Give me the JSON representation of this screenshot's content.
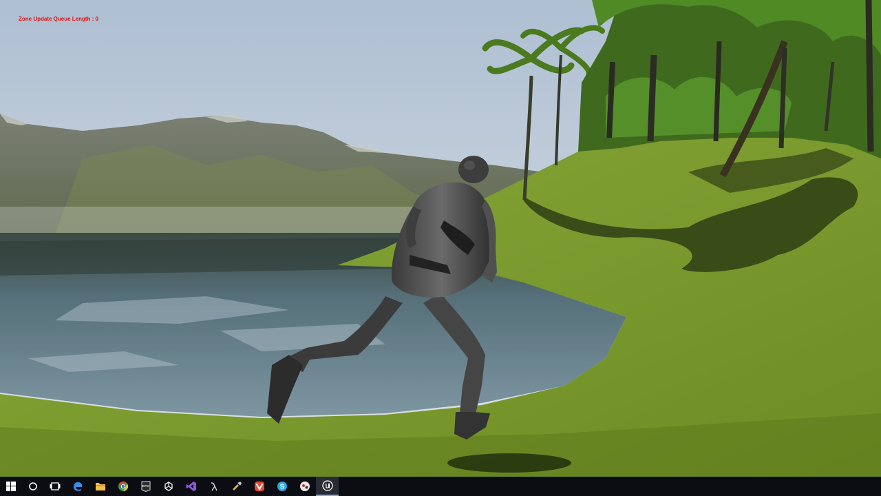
{
  "hud": {
    "zone_update_text": "Zone Update Queue Length : 0",
    "text_color": "#e01010"
  },
  "scene": {
    "sky_top": "#b7c6d6",
    "sky_bottom": "#d8dfe6",
    "mountain_color": "#6f7562",
    "water_color": "#5f7482",
    "grass_color": "#7a9a2c",
    "shadow_color": "#1f2a10",
    "character_color": "#4a4a4a"
  },
  "taskbar": {
    "background": "#0c0d12",
    "items": [
      {
        "name": "windows-start",
        "icon": "windows-logo-icon",
        "color": "#ffffff"
      },
      {
        "name": "search",
        "icon": "cortana-circle-icon",
        "color": "#ffffff"
      },
      {
        "name": "task-view",
        "icon": "task-view-icon",
        "color": "#ffffff"
      },
      {
        "name": "edge",
        "icon": "edge-browser-icon",
        "color": "#3b8ee8"
      },
      {
        "name": "file-explorer",
        "icon": "folder-icon",
        "color": "#f2c04a"
      },
      {
        "name": "chrome",
        "icon": "chrome-icon",
        "color": "#d94a3a"
      },
      {
        "name": "epic-launcher",
        "icon": "epic-games-icon",
        "color": "#dddddd",
        "label": "EPIC"
      },
      {
        "name": "unity",
        "icon": "unity-icon",
        "color": "#eeeeee"
      },
      {
        "name": "visual-studio",
        "icon": "visual-studio-icon",
        "color": "#8a5bd6"
      },
      {
        "name": "app-lambda",
        "icon": "lambda-icon",
        "color": "#dddddd"
      },
      {
        "name": "app-tool",
        "icon": "tool-icon",
        "color": "#e0b040"
      },
      {
        "name": "vivaldi",
        "icon": "vivaldi-icon",
        "color": "#e24a35"
      },
      {
        "name": "skype",
        "icon": "skype-icon",
        "color": "#2aa8e8"
      },
      {
        "name": "app-chat",
        "icon": "chat-icon",
        "color": "#e8e8e8"
      },
      {
        "name": "unreal-engine",
        "icon": "unreal-engine-icon",
        "color": "#ffffff",
        "active": true
      }
    ]
  }
}
